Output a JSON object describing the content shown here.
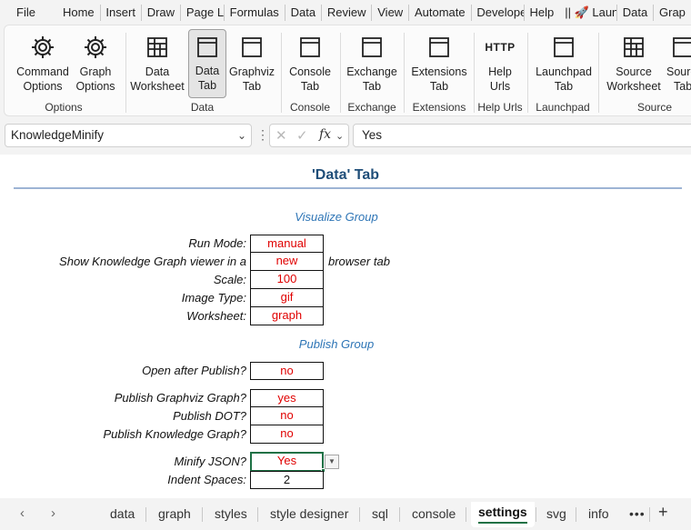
{
  "menu": [
    "File",
    "Home",
    "Insert",
    "Draw",
    "Page Layo",
    "Formulas",
    "Data",
    "Review",
    "View",
    "Automate",
    "Develope",
    "Help",
    "|| 🚀 Laun",
    "Data",
    "Grap"
  ],
  "ribbon": {
    "groups": [
      {
        "label": "Options",
        "buttons": [
          {
            "line1": "Command",
            "line2": "Options",
            "icon": "gear-icon"
          },
          {
            "line1": "Graph",
            "line2": "Options",
            "icon": "gear-icon"
          }
        ]
      },
      {
        "label": "Data",
        "buttons": [
          {
            "line1": "Data",
            "line2": "Worksheet",
            "icon": "grid-icon"
          },
          {
            "line1": "Data",
            "line2": "Tab",
            "icon": "window-icon",
            "active": true
          },
          {
            "line1": "Graphviz",
            "line2": "Tab",
            "icon": "window-icon"
          }
        ]
      },
      {
        "label": "Console",
        "buttons": [
          {
            "line1": "Console",
            "line2": "Tab",
            "icon": "window-icon"
          }
        ]
      },
      {
        "label": "Exchange",
        "buttons": [
          {
            "line1": "Exchange",
            "line2": "Tab",
            "icon": "window-icon"
          }
        ]
      },
      {
        "label": "Extensions",
        "buttons": [
          {
            "line1": "Extensions",
            "line2": "Tab",
            "icon": "window-icon"
          }
        ]
      },
      {
        "label": "Help Urls",
        "buttons": [
          {
            "line1": "Help",
            "line2": "Urls",
            "icon": "http-icon",
            "icon_text": "HTTP"
          }
        ]
      },
      {
        "label": "Launchpad",
        "buttons": [
          {
            "line1": "Launchpad",
            "line2": "Tab",
            "icon": "window-icon"
          }
        ]
      },
      {
        "label": "Source",
        "buttons": [
          {
            "line1": "Source",
            "line2": "Worksheet",
            "icon": "grid-icon"
          },
          {
            "line1": "Sourc",
            "line2": "Tab",
            "icon": "window-icon"
          }
        ]
      }
    ]
  },
  "formula_bar": {
    "name_box": "KnowledgeMinify",
    "fx": "fx",
    "content": "Yes"
  },
  "sheet": {
    "title": "'Data' Tab",
    "sections": {
      "visualize": "Visualize Group",
      "publish": "Publish Group"
    },
    "rows": [
      {
        "label": "Run Mode:",
        "value": "manual"
      },
      {
        "label": "Show Knowledge Graph viewer in a",
        "value": "new",
        "after": "browser tab"
      },
      {
        "label": "Scale:",
        "value": "100"
      },
      {
        "label": "Image Type:",
        "value": "gif"
      },
      {
        "label": "Worksheet:",
        "value": "graph"
      },
      {
        "label": "Open after Publish?",
        "value": "no"
      },
      {
        "label": "Publish Graphviz Graph?",
        "value": "yes"
      },
      {
        "label": "Publish DOT?",
        "value": "no"
      },
      {
        "label": "Publish Knowledge Graph?",
        "value": "no"
      },
      {
        "label": "Minify JSON?",
        "value": "Yes"
      },
      {
        "label": "Indent Spaces:",
        "value": "2"
      }
    ]
  },
  "tabs": [
    "data",
    "graph",
    "styles",
    "style designer",
    "sql",
    "console",
    "settings",
    "svg",
    "info"
  ],
  "active_tab": "settings",
  "colors": {
    "accent_green": "#1e7145",
    "title_blue": "#1f4e79",
    "section_blue": "#2e75b6",
    "value_red": "#e00000"
  }
}
